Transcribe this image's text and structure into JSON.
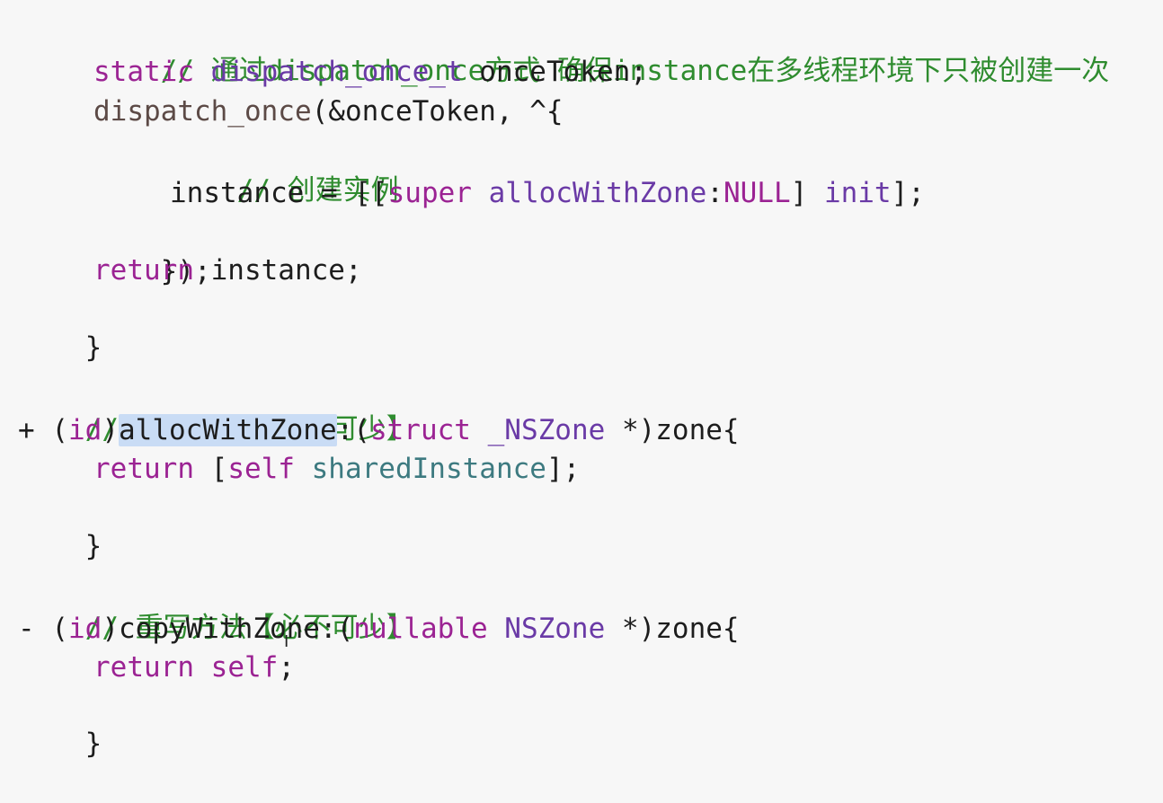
{
  "code": {
    "l1_comment": "// 通过dispatch_once方式 确保instance在多线程环境下只被创建一次",
    "l2_static": "static",
    "l2_type": "dispatch_once_t",
    "l2_var": "onceToken;",
    "l3_func": "dispatch_once",
    "l3_args": "(&onceToken, ^{",
    "l4_comment": "// 创建实例",
    "l5_lhs": "instance = [[",
    "l5_super": "super",
    "l5_method": "allocWithZone",
    "l5_colon": ":",
    "l5_null": "NULL",
    "l5_close": "] ",
    "l5_init": "init",
    "l5_end": "];",
    "l6_close": "});",
    "l7_return": "return",
    "l7_rest": " instance;",
    "l8_brace": "}",
    "l10_comment": "// 重写方法【必不可少】",
    "l11_prefix": "+ (",
    "l11_id": "id",
    "l11_paren": ")",
    "l11_method": "allocWithZone",
    "l11_colon": ":(",
    "l11_struct": "struct",
    "l11_nszone": "_NSZone",
    "l11_rest": " *)zone{",
    "l12_return": "return",
    "l12_open": " [",
    "l12_self": "self",
    "l12_shared": "sharedInstance",
    "l12_end": "];",
    "l13_brace": "}",
    "l15_comment": "// 重写方法【必不可少】",
    "l16_prefix": "- (",
    "l16_id": "id",
    "l16_paren": ")copyWithZone:(",
    "l16_nullable": "nullable",
    "l16_nszone": "NSZone",
    "l16_rest": " *)zone{",
    "l17_return": "return",
    "l17_self": "self",
    "l17_end": ";",
    "l18_brace": "}"
  },
  "cursor_glyph": "I",
  "colors": {
    "comment": "#2f8c2f",
    "keyword": "#9b2393",
    "type": "#6a3aa6",
    "selection": "#c9dcf5"
  }
}
